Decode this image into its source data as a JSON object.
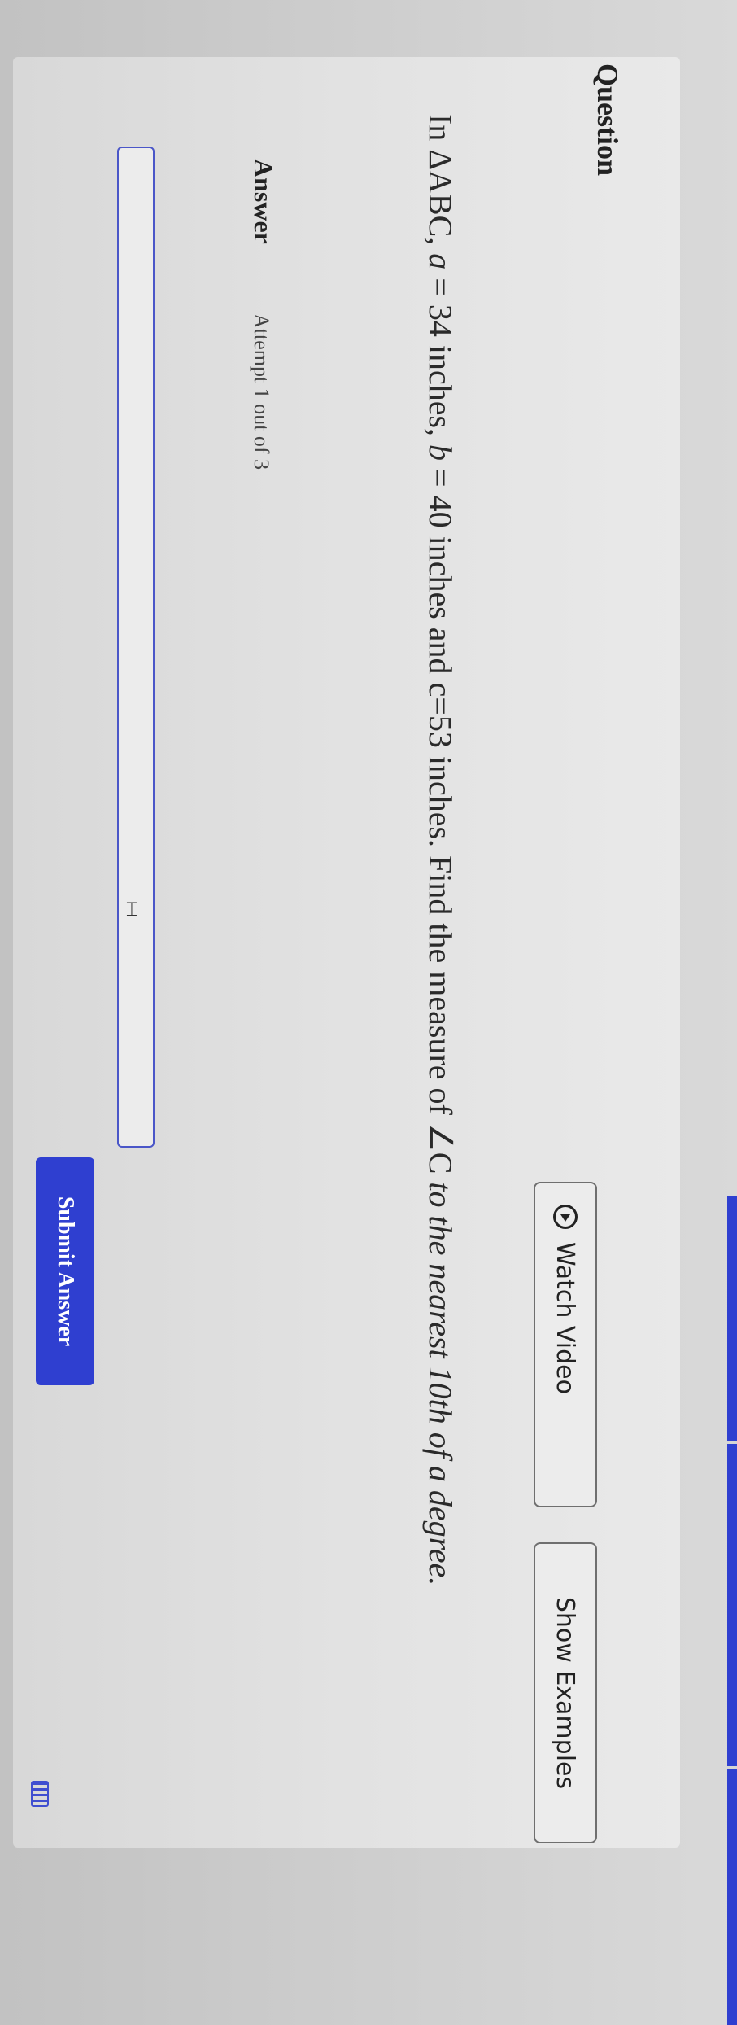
{
  "question": {
    "heading": "Question",
    "watch_video_label": "Watch Video",
    "show_examples_label": "Show Examples",
    "text_parts": {
      "p1": "In ΔABC, ",
      "a_var": "a",
      "p2": " = 34 inches, ",
      "b_var": "b",
      "p3": " = 40 inches and c=53 inches. Find the measure of ∠C ",
      "p4_italic": "to the nearest 10th of a degree."
    }
  },
  "answer": {
    "heading": "Answer",
    "attempt": "Attempt 1 out of 3",
    "input_value": "",
    "submit_label": "Submit Answer"
  },
  "icons": {
    "watch_video": "play-circle-icon",
    "keypad": "keypad-icon",
    "text_cursor": "text-cursor-icon"
  },
  "colors": {
    "accent": "#2f3fd0",
    "input_border": "#4a56c8"
  }
}
